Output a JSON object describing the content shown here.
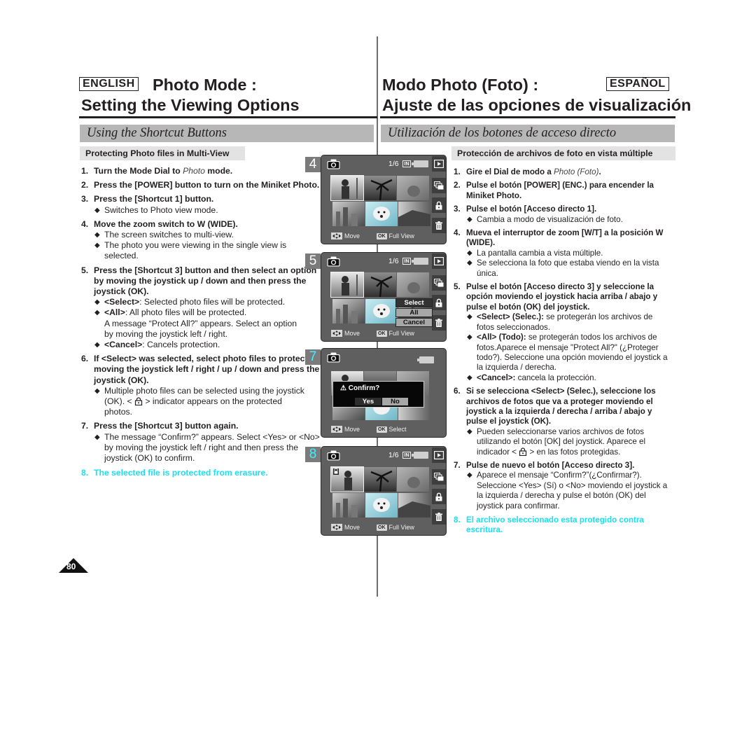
{
  "header": {
    "en_lang": "ENGLISH",
    "en_title_1": "Photo Mode :",
    "en_title_2": "Setting the Viewing Options",
    "es_lang": "ESPAÑOL",
    "es_title_1": "Modo Photo (Foto) :",
    "es_title_2": "Ajuste de las opciones de visualización"
  },
  "sections": {
    "en_bar": "Using the Shortcut Buttons",
    "es_bar": "Utilización de los botones de acceso directo",
    "en_sub": "Protecting Photo files in Multi-View",
    "es_sub": "Protección de archivos de foto en vista múltiple"
  },
  "english": {
    "s1": {
      "num": "1.",
      "a": "Turn the Mode Dial to ",
      "i": "Photo",
      "b": " mode."
    },
    "s2": {
      "num": "2.",
      "t": "Press the [POWER] button to turn on the Miniket Photo."
    },
    "s3": {
      "num": "3.",
      "t": "Press the [Shortcut 1] button.",
      "b1": "Switches to Photo view mode."
    },
    "s4": {
      "num": "4.",
      "t": "Move the zoom switch to W (WIDE).",
      "b1": "The screen switches to multi-view.",
      "b2": "The photo you were viewing in the single view is selected."
    },
    "s5": {
      "num": "5.",
      "t": "Press the [Shortcut 3] button and then select an option by moving the joystick up / down and then press the joystick (OK).",
      "b1k": "<Select>",
      "b1": ": Selected photo files will be protected.",
      "b2k": "<All>",
      "b2": ": All photo files will be protected.",
      "b2x": "A message “Protect All?” appears. Select an option by moving the joystick left / right.",
      "b3k": "<Cancel>",
      "b3": ": Cancels protection."
    },
    "s6": {
      "num": "6.",
      "t": "If <Select> was selected, select photo files to protect by moving the joystick left / right / up / down and press the joystick (OK).",
      "b1a": "Multiple photo files can be selected using the joystick (OK). < ",
      "b1b": " > indicator appears on the protected photos."
    },
    "s7": {
      "num": "7.",
      "t": "Press the [Shortcut 3] button again.",
      "b1": "The message “Confirm?” appears. Select <Yes> or <No> by moving the joystick left / right and then press the joystick (OK) to confirm."
    },
    "s8": {
      "num": "8.",
      "t": "The selected file is protected from erasure."
    }
  },
  "spanish": {
    "s1": {
      "num": "1.",
      "a": "Gire el Dial de modo a ",
      "i": "Photo (Foto)",
      "b": "."
    },
    "s2": {
      "num": "2.",
      "t": "Pulse el botón [POWER] (ENC.) para encender la Miniket Photo."
    },
    "s3": {
      "num": "3.",
      "t": "Pulse el botón [Acceso directo 1].",
      "b1": "Cambia a modo de visualización de foto."
    },
    "s4": {
      "num": "4.",
      "t": "Mueva el interruptor de zoom [W/T] a la posición W (WIDE).",
      "b1": "La pantalla cambia a vista múltiple.",
      "b2": "Se selecciona la foto que estaba viendo en la vista única."
    },
    "s5": {
      "num": "5.",
      "t": "Pulse el botón [Acceso directo 3] y seleccione la opción moviendo el joystick hacia arriba / abajo y pulse el botón (OK) del joystick.",
      "b1k": "<Select> (Selec.):",
      "b1": " se protegerán los archivos de fotos seleccionados.",
      "b2k": "<All> (Todo):",
      "b2": " se protegerán todos los archivos de fotos.Aparece el mensaje \"Protect All?\" (¿Proteger todo?). Seleccione una opción moviendo el joystick a la izquierda / derecha.",
      "b3k": "<Cancel>:",
      "b3": " cancela la protección."
    },
    "s6": {
      "num": "6.",
      "t": "Si se selecciona <Select> (Selec.), seleccione los archivos de fotos que va a proteger moviendo el joystick a la izquierda / derecha / arriba / abajo y pulse el joystick (OK).",
      "b1a": "Pueden seleccionarse varios archivos de fotos utilizando el botón [OK] del joystick. Aparece el indicador < ",
      "b1b": " > en las fotos protegidas."
    },
    "s7": {
      "num": "7.",
      "t": "Pulse de nuevo el botón [Acceso directo 3].",
      "b1": "Aparece el mensaje “Confirm?”(¿Confirmar?). Seleccione <Yes> (Sí) o <No> moviendo el joystick a la izquierda / derecha y pulse el botón (OK) del joystick para confirmar."
    },
    "s8": {
      "num": "8.",
      "t": "El archivo seleccionado esta protegido contra escritura."
    }
  },
  "screens": {
    "p4": {
      "step": "4",
      "counter": "1/6",
      "storage": "IN",
      "move": "Move",
      "ok_key": "OK",
      "ok_action": "Full View"
    },
    "p5": {
      "step": "5",
      "counter": "1/6",
      "storage": "IN",
      "move": "Move",
      "ok_key": "OK",
      "ok_action": "Full View",
      "menu": [
        "Select",
        "All",
        "Cancel"
      ],
      "menu_selected": "Select"
    },
    "p7": {
      "step": "7",
      "confirm_title": "Confirm?",
      "yes": "Yes",
      "no": "No",
      "move": "Move",
      "ok_key": "OK",
      "ok_action": "Select"
    },
    "p8": {
      "step": "8",
      "counter": "1/6",
      "storage": "IN",
      "move": "Move",
      "ok_key": "OK",
      "ok_action": "Full View"
    }
  },
  "colors": {
    "highlight_step": "#19e0f0",
    "section_bar": "#b7b7b7",
    "sub_bar": "#e3e3e3",
    "lcd_bg": "#5f5f5f"
  },
  "footer": {
    "page_number": "80"
  }
}
